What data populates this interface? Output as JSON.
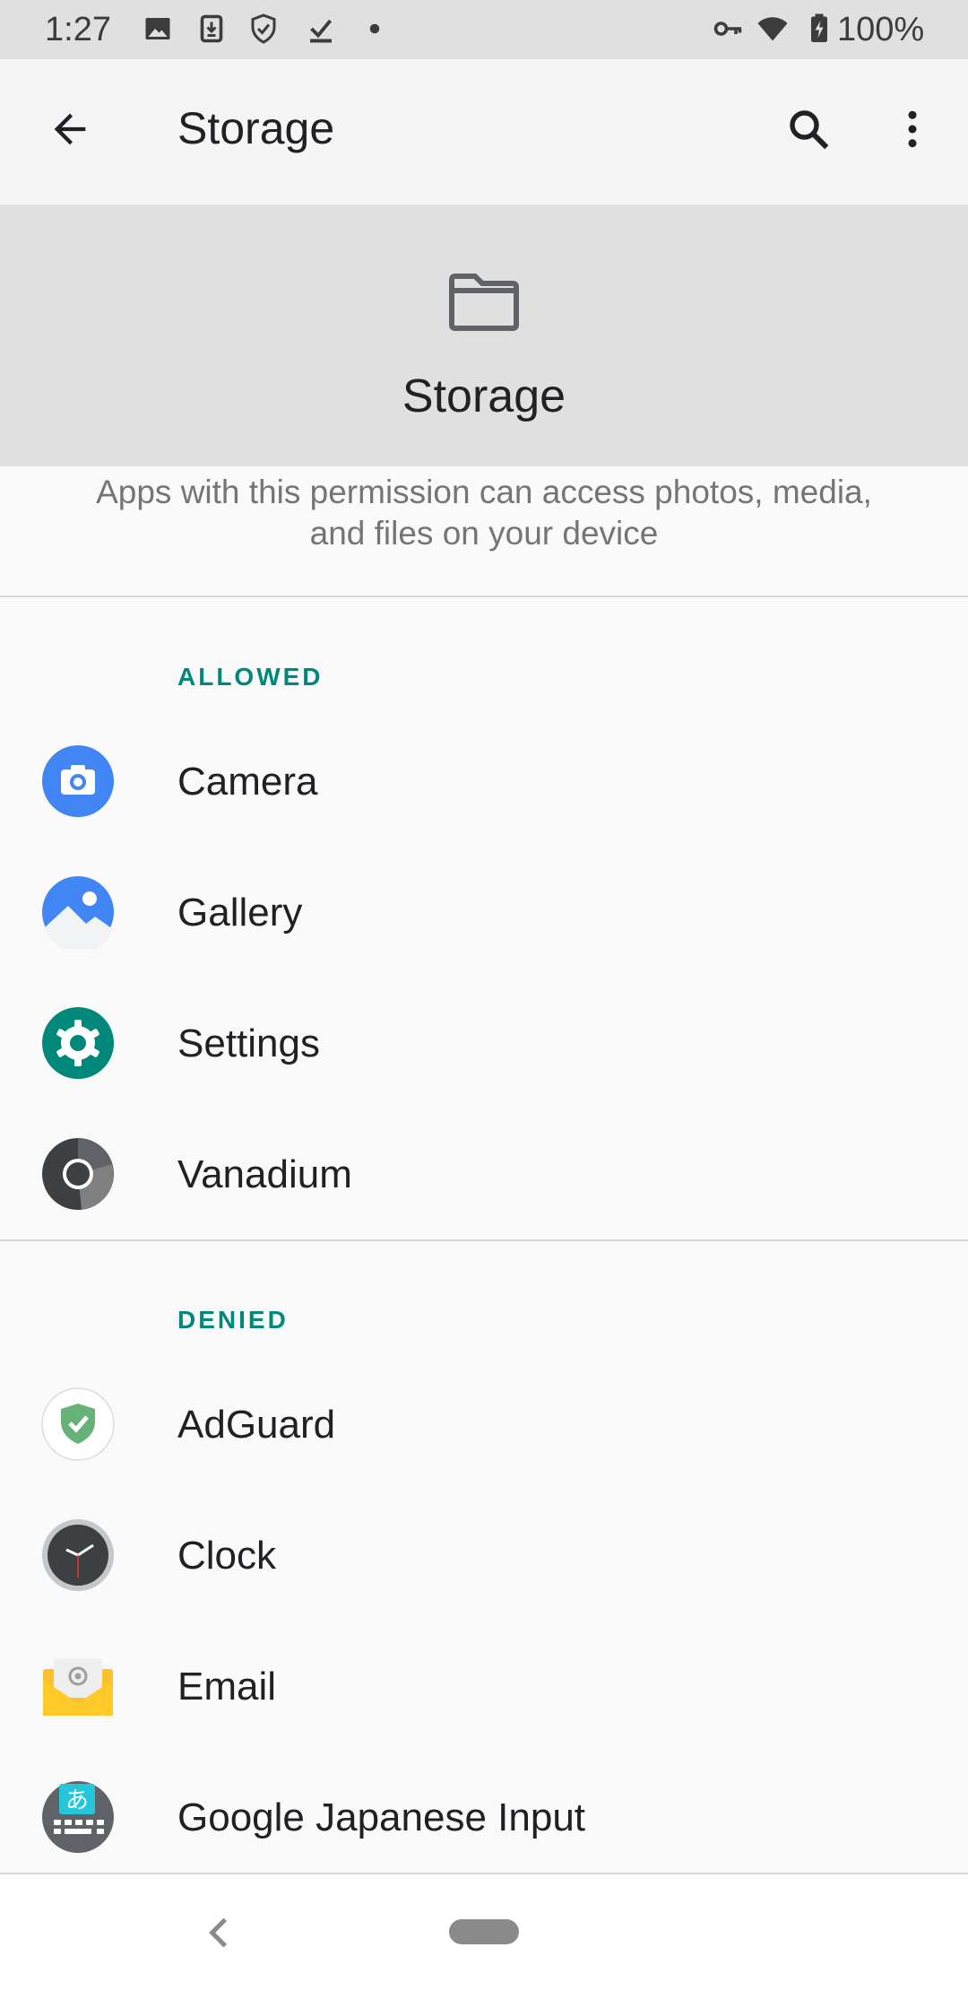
{
  "status_bar": {
    "time": "1:27",
    "battery": "100%",
    "icons": [
      "image-icon",
      "download-icon",
      "shield-icon",
      "check-download-icon",
      "dot-icon",
      "vpn-key-icon",
      "wifi-icon",
      "battery-icon"
    ]
  },
  "toolbar": {
    "title": "Storage",
    "back_icon": "arrow-back-icon",
    "search_icon": "search-icon",
    "menu_icon": "more-vert-icon"
  },
  "header": {
    "icon": "folder-icon",
    "title": "Storage",
    "description": "Apps with this permission can access photos, media, and files on your device"
  },
  "sections": {
    "allowed": {
      "label": "ALLOWED",
      "apps": [
        {
          "name": "Camera",
          "icon": "camera-app-icon"
        },
        {
          "name": "Gallery",
          "icon": "gallery-app-icon"
        },
        {
          "name": "Settings",
          "icon": "settings-app-icon"
        },
        {
          "name": "Vanadium",
          "icon": "vanadium-app-icon"
        }
      ]
    },
    "denied": {
      "label": "DENIED",
      "apps": [
        {
          "name": "AdGuard",
          "icon": "adguard-app-icon"
        },
        {
          "name": "Clock",
          "icon": "clock-app-icon"
        },
        {
          "name": "Email",
          "icon": "email-app-icon"
        },
        {
          "name": "Google Japanese Input",
          "icon": "japanese-input-app-icon"
        }
      ]
    }
  },
  "japanese_input_glyph": "あ",
  "colors": {
    "accent": "#00897b",
    "header_band": "#e0e0e0",
    "background": "#fafafa"
  }
}
